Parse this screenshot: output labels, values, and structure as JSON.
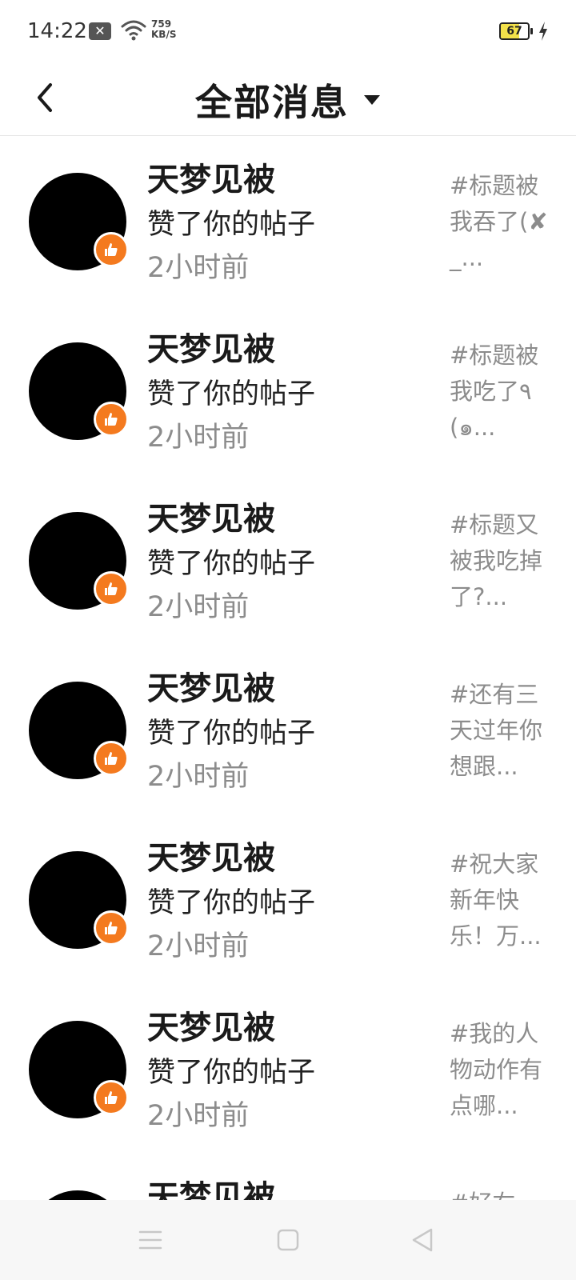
{
  "status_bar": {
    "time": "14:22",
    "speed_value": "759",
    "speed_unit": "KB/S",
    "battery_percent": 67,
    "battery_label": "67",
    "icons": [
      "notification-x-icon",
      "wifi-icon",
      "charging-bolt-icon"
    ]
  },
  "header": {
    "back_icon": "chevron-left-icon",
    "title": "全部消息",
    "dropdown_icon": "caret-down-icon"
  },
  "colors": {
    "accent": "#f47a1f",
    "battery_fill": "#f3e14a",
    "secondary_text": "#8c8c8c"
  },
  "messages": [
    {
      "name": "天梦见被",
      "action": "赞了你的帖子",
      "time": "2小时前",
      "preview": "#标题被我吞了(✘_..."
    },
    {
      "name": "天梦见被",
      "action": "赞了你的帖子",
      "time": "2小时前",
      "preview": "#标题被我吃了٩(๑..."
    },
    {
      "name": "天梦见被",
      "action": "赞了你的帖子",
      "time": "2小时前",
      "preview": "#标题又被我吃掉了?..."
    },
    {
      "name": "天梦见被",
      "action": "赞了你的帖子",
      "time": "2小时前",
      "preview": "#还有三天过年你想跟..."
    },
    {
      "name": "天梦见被",
      "action": "赞了你的帖子",
      "time": "2小时前",
      "preview": "#祝大家新年快乐！万..."
    },
    {
      "name": "天梦见被",
      "action": "赞了你的帖子",
      "time": "2小时前",
      "preview": "#我的人物动作有点哪..."
    },
    {
      "name": "天梦见被",
      "action": "",
      "time": "",
      "preview": "#好右"
    }
  ],
  "nav_bar": {
    "icons": [
      "menu-icon",
      "home-square-icon",
      "back-triangle-icon"
    ]
  }
}
